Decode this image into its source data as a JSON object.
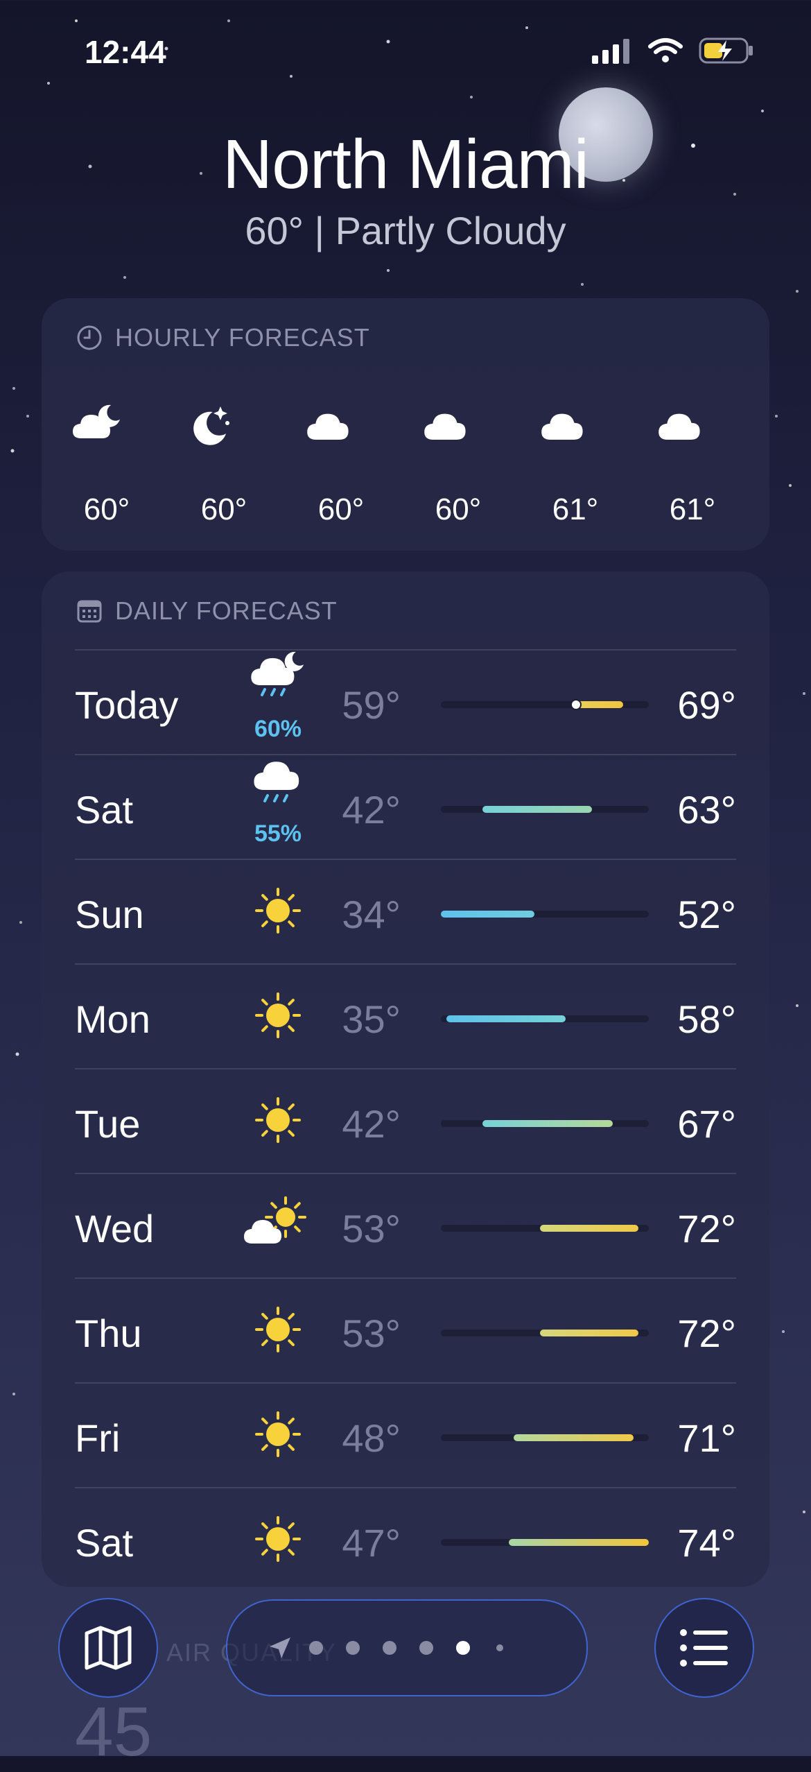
{
  "status_bar": {
    "time": "12:44"
  },
  "header": {
    "city": "North Miami",
    "summary": "60°  |  Partly Cloudy"
  },
  "hourly": {
    "title": "HOURLY FORECAST",
    "items": [
      {
        "icon": "cloud-moon-icon",
        "temp": "60°"
      },
      {
        "icon": "moon-stars-icon",
        "temp": "60°"
      },
      {
        "icon": "cloud-icon",
        "temp": "60°"
      },
      {
        "icon": "cloud-icon",
        "temp": "60°"
      },
      {
        "icon": "cloud-icon",
        "temp": "61°"
      },
      {
        "icon": "cloud-icon",
        "temp": "61°"
      }
    ]
  },
  "daily": {
    "title": "DAILY FORECAST",
    "range_min": 34,
    "range_max": 74,
    "days": [
      {
        "day": "Today",
        "icon": "cloud-moon-rain-icon",
        "precip": "60%",
        "low": "59°",
        "high": "69°",
        "low_val": 59,
        "high_val": 69,
        "colors": [
          "#e9d15a",
          "#f0c53f"
        ],
        "current": 60
      },
      {
        "day": "Sat",
        "icon": "cloud-rain-icon",
        "precip": "55%",
        "low": "42°",
        "high": "63°",
        "low_val": 42,
        "high_val": 63,
        "colors": [
          "#77d1d8",
          "#9ad6b0"
        ]
      },
      {
        "day": "Sun",
        "icon": "sun-icon",
        "precip": "",
        "low": "34°",
        "high": "52°",
        "low_val": 34,
        "high_val": 52,
        "colors": [
          "#5ec2ea",
          "#6fcce0"
        ]
      },
      {
        "day": "Mon",
        "icon": "sun-icon",
        "precip": "",
        "low": "35°",
        "high": "58°",
        "low_val": 35,
        "high_val": 58,
        "colors": [
          "#5ec2ea",
          "#76d1d8"
        ]
      },
      {
        "day": "Tue",
        "icon": "sun-icon",
        "precip": "",
        "low": "42°",
        "high": "67°",
        "low_val": 42,
        "high_val": 67,
        "colors": [
          "#77d1d8",
          "#b6d898"
        ]
      },
      {
        "day": "Wed",
        "icon": "cloud-sun-icon",
        "precip": "",
        "low": "53°",
        "high": "72°",
        "low_val": 53,
        "high_val": 72,
        "colors": [
          "#d5d77c",
          "#f0c948"
        ]
      },
      {
        "day": "Thu",
        "icon": "sun-icon",
        "precip": "",
        "low": "53°",
        "high": "72°",
        "low_val": 53,
        "high_val": 72,
        "colors": [
          "#d5d77c",
          "#f0c948"
        ]
      },
      {
        "day": "Fri",
        "icon": "sun-icon",
        "precip": "",
        "low": "48°",
        "high": "71°",
        "low_val": 48,
        "high_val": 71,
        "colors": [
          "#b4d8a0",
          "#f0c948"
        ]
      },
      {
        "day": "Sat",
        "icon": "sun-icon",
        "precip": "",
        "low": "47°",
        "high": "74°",
        "low_val": 47,
        "high_val": 74,
        "colors": [
          "#a8d6a8",
          "#f3c53a"
        ]
      }
    ]
  },
  "air_quality": {
    "label": "AIR QUALITY",
    "value": "45"
  },
  "pager": {
    "total_dots": 6,
    "active_index": 4
  },
  "colors": {
    "sun": "#f7d23a",
    "precip": "#5ec2f0",
    "accent_border": "#466ee6"
  }
}
